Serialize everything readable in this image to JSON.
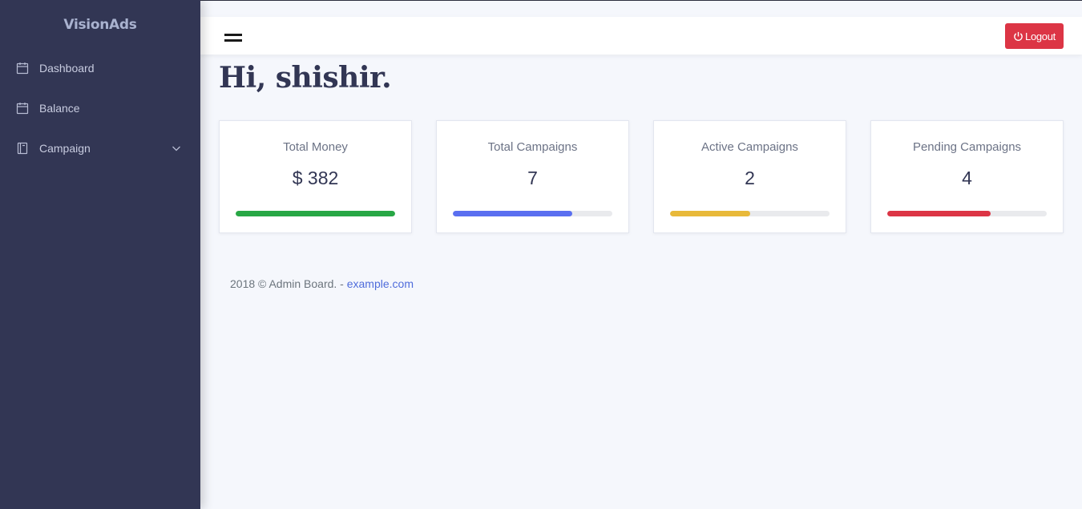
{
  "brand": "VisionAds",
  "sidebar": {
    "items": [
      {
        "label": "Dashboard",
        "icon": "calendar-icon"
      },
      {
        "label": "Balance",
        "icon": "calendar-icon"
      },
      {
        "label": "Campaign",
        "icon": "book-icon",
        "has_submenu": true
      }
    ]
  },
  "topbar": {
    "menu_icon": "hamburger-icon",
    "logout_label": "Logout",
    "logout_icon": "power-icon"
  },
  "greeting": {
    "prefix": "Hi, ",
    "name": "shishir",
    "suffix": "."
  },
  "cards": [
    {
      "label": "Total Money",
      "value": "$ 382",
      "progress": 1.0,
      "color": "#28a745"
    },
    {
      "label": "Total Campaigns",
      "value": "7",
      "progress": 0.75,
      "color": "#5a6ff0"
    },
    {
      "label": "Active Campaigns",
      "value": "2",
      "progress": 0.5,
      "color": "#e8b93a"
    },
    {
      "label": "Pending Campaigns",
      "value": "4",
      "progress": 0.65,
      "color": "#dc3545"
    }
  ],
  "footer": {
    "text": "2018 © Admin Board. - ",
    "link": "example.com"
  },
  "colors": {
    "sidebar_bg": "#323654",
    "logout_bg": "#dc3545",
    "link": "#4f6cdb"
  }
}
